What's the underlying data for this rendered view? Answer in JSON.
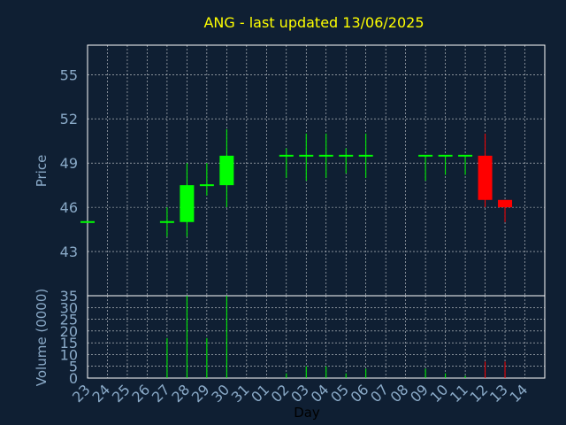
{
  "chart_data": {
    "type": "candlestick",
    "title": "ANG - last updated 13/06/2025",
    "xlabel": "Day",
    "price_panel": {
      "ylabel": "Price",
      "ylim": [
        40,
        57
      ],
      "yticks": [
        43,
        46,
        49,
        52,
        55
      ],
      "grid": true
    },
    "volume_panel": {
      "ylabel": "Volume (0000)",
      "ylim": [
        0,
        35
      ],
      "yticks": [
        0,
        5,
        10,
        15,
        20,
        25,
        30,
        35
      ],
      "grid": true
    },
    "x_tick_labels": [
      "23",
      "24",
      "25",
      "26",
      "27",
      "28",
      "29",
      "30",
      "31",
      "01",
      "02",
      "03",
      "04",
      "05",
      "06",
      "07",
      "08",
      "09",
      "10",
      "11",
      "12",
      "13",
      "14"
    ],
    "candles": [
      {
        "day": "23",
        "open": 45.0,
        "high": 45.0,
        "low": 45.0,
        "close": 45.0,
        "volume": 0
      },
      {
        "day": "27",
        "open": 45.0,
        "high": 46.0,
        "low": 44.0,
        "close": 45.0,
        "volume": 17
      },
      {
        "day": "28",
        "open": 45.0,
        "high": 49.0,
        "low": 44.0,
        "close": 47.5,
        "volume": 35
      },
      {
        "day": "29",
        "open": 47.5,
        "high": 49.0,
        "low": 46.8,
        "close": 47.5,
        "volume": 17
      },
      {
        "day": "30",
        "open": 47.5,
        "high": 51.3,
        "low": 46.0,
        "close": 49.5,
        "volume": 35
      },
      {
        "day": "02",
        "open": 49.5,
        "high": 50.0,
        "low": 48.0,
        "close": 49.5,
        "volume": 2
      },
      {
        "day": "03",
        "open": 49.5,
        "high": 51.0,
        "low": 47.8,
        "close": 49.5,
        "volume": 5
      },
      {
        "day": "04",
        "open": 49.5,
        "high": 51.0,
        "low": 48.0,
        "close": 49.5,
        "volume": 5
      },
      {
        "day": "05",
        "open": 49.5,
        "high": 50.0,
        "low": 48.3,
        "close": 49.5,
        "volume": 2
      },
      {
        "day": "06",
        "open": 49.5,
        "high": 51.0,
        "low": 48.0,
        "close": 49.5,
        "volume": 4
      },
      {
        "day": "09",
        "open": 49.5,
        "high": 49.5,
        "low": 47.8,
        "close": 49.5,
        "volume": 4
      },
      {
        "day": "10",
        "open": 49.5,
        "high": 49.5,
        "low": 48.2,
        "close": 49.5,
        "volume": 2
      },
      {
        "day": "11",
        "open": 49.5,
        "high": 49.5,
        "low": 48.2,
        "close": 49.5,
        "volume": 1
      },
      {
        "day": "12",
        "open": 49.5,
        "high": 51.0,
        "low": 46.0,
        "close": 46.5,
        "volume": 7
      },
      {
        "day": "13",
        "open": 46.5,
        "high": 46.5,
        "low": 45.0,
        "close": 46.0,
        "volume": 7
      }
    ],
    "colors": {
      "background": "#0f1f33",
      "plot_background": "#0f1f33",
      "axes": "#ffffff",
      "grid": "#ffffff",
      "tick_text": "#8aaac8",
      "title_text": "#ffff00",
      "up": "#00ff00",
      "down": "#ff0000",
      "xlabel_text": "#000000"
    }
  }
}
